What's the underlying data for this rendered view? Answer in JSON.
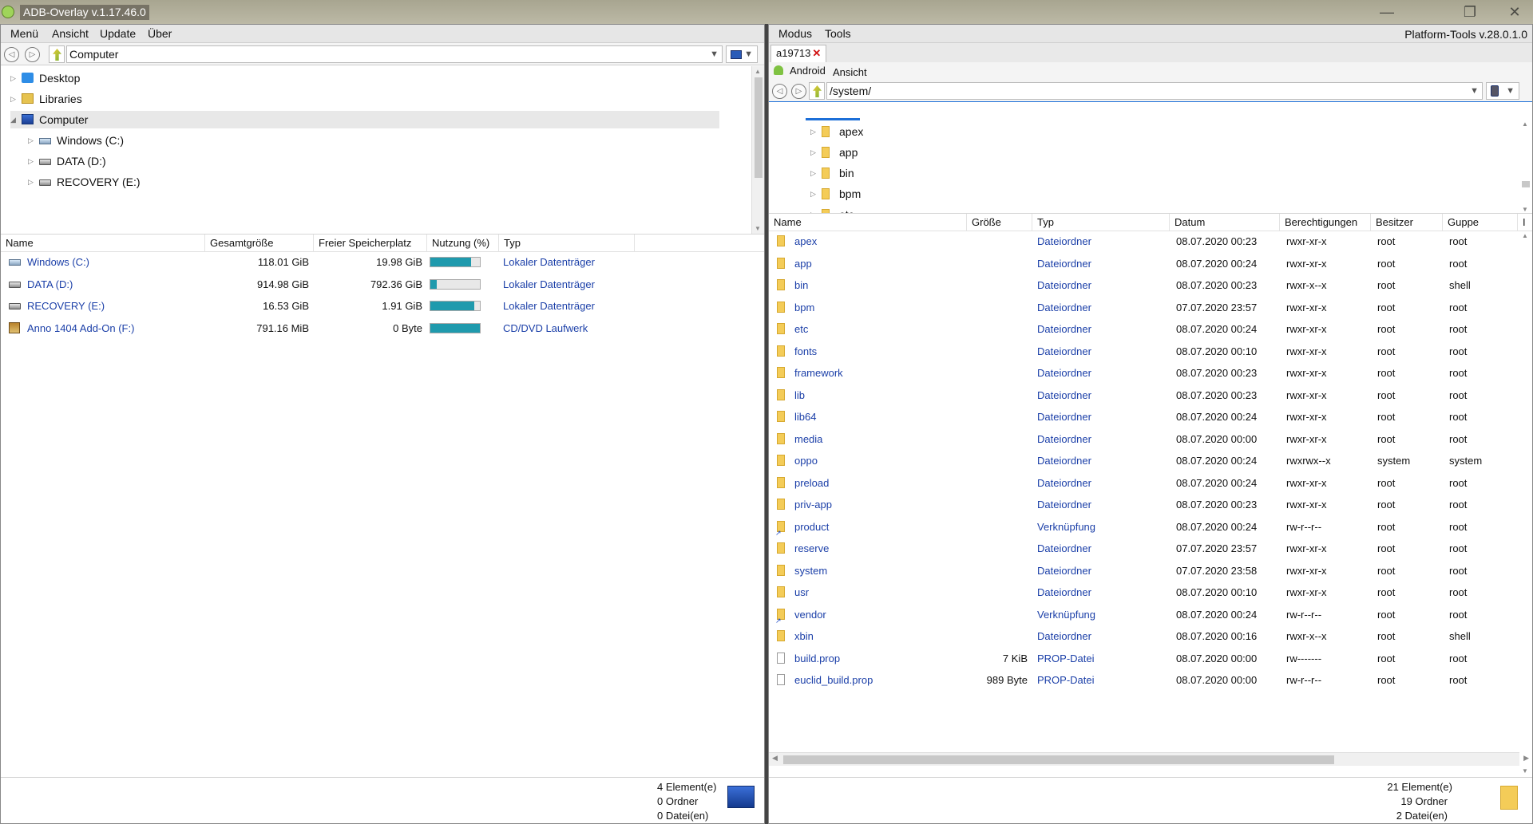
{
  "window": {
    "title": "ADB-Overlay v.1.17.46.0",
    "controls": [
      "minimize-icon",
      "restore-icon",
      "close-icon"
    ]
  },
  "left": {
    "menu": [
      "Menü",
      "Ansicht",
      "Update",
      "Über"
    ],
    "address": {
      "value": "Computer"
    },
    "tree": [
      {
        "label": "Desktop",
        "icon": "desktop-icon",
        "level": 0,
        "expander": "▷"
      },
      {
        "label": "Libraries",
        "icon": "libraries-icon",
        "level": 0,
        "expander": "▷"
      },
      {
        "label": "Computer",
        "icon": "computer-icon",
        "level": 0,
        "expander": "◢"
      },
      {
        "label": "Windows (C:)",
        "icon": "windows-drive-icon",
        "level": 1,
        "expander": "▷"
      },
      {
        "label": "DATA (D:)",
        "icon": "drive-icon",
        "level": 1,
        "expander": "▷"
      },
      {
        "label": "RECOVERY (E:)",
        "icon": "drive-icon",
        "level": 1,
        "expander": "▷"
      }
    ],
    "columns": [
      "Name",
      "Gesamtgröße",
      "Freier Speicherplatz",
      "Nutzung (%)",
      "Typ"
    ],
    "drives": [
      {
        "name": "Windows (C:)",
        "total": "118.01 GiB",
        "free": "19.98 GiB",
        "usage": 83,
        "type": "Lokaler Datenträger",
        "icon": "windows-drive-icon"
      },
      {
        "name": "DATA (D:)",
        "total": "914.98 GiB",
        "free": "792.36 GiB",
        "usage": 13,
        "type": "Lokaler Datenträger",
        "icon": "drive-icon"
      },
      {
        "name": "RECOVERY (E:)",
        "total": "16.53 GiB",
        "free": "1.91 GiB",
        "usage": 88,
        "type": "Lokaler Datenträger",
        "icon": "drive-icon"
      },
      {
        "name": "Anno 1404 Add-On (F:)",
        "total": "791.16 MiB",
        "free": "0 Byte",
        "usage": 100,
        "type": "CD/DVD Laufwerk",
        "icon": "cd-icon"
      }
    ],
    "status": {
      "elements": "4 Element(e)",
      "folders": "0 Ordner",
      "files": "0 Datei(en)"
    }
  },
  "right": {
    "menu": [
      "Modus",
      "Tools"
    ],
    "platform": "Platform-Tools v.28.0.1.0",
    "tab": {
      "label": "a19713",
      "close": "✕"
    },
    "subbar": {
      "android": "Android",
      "ansicht": "Ansicht"
    },
    "address": {
      "value": "/system/"
    },
    "tree": [
      "apex",
      "app",
      "bin",
      "bpm",
      "etc"
    ],
    "columns": [
      "Name",
      "Größe",
      "Typ",
      "Datum",
      "Berechtigungen",
      "Besitzer",
      "Guppe",
      "I"
    ],
    "files": [
      {
        "name": "apex",
        "size": "",
        "type": "Dateiordner",
        "date": "08.07.2020 00:23",
        "perm": "rwxr-xr-x",
        "owner": "root",
        "group": "root",
        "icon": "folder-icon"
      },
      {
        "name": "app",
        "size": "",
        "type": "Dateiordner",
        "date": "08.07.2020 00:24",
        "perm": "rwxr-xr-x",
        "owner": "root",
        "group": "root",
        "icon": "folder-icon"
      },
      {
        "name": "bin",
        "size": "",
        "type": "Dateiordner",
        "date": "08.07.2020 00:23",
        "perm": "rwxr-x--x",
        "owner": "root",
        "group": "shell",
        "icon": "folder-icon"
      },
      {
        "name": "bpm",
        "size": "",
        "type": "Dateiordner",
        "date": "07.07.2020 23:57",
        "perm": "rwxr-xr-x",
        "owner": "root",
        "group": "root",
        "icon": "folder-icon"
      },
      {
        "name": "etc",
        "size": "",
        "type": "Dateiordner",
        "date": "08.07.2020 00:24",
        "perm": "rwxr-xr-x",
        "owner": "root",
        "group": "root",
        "icon": "folder-icon"
      },
      {
        "name": "fonts",
        "size": "",
        "type": "Dateiordner",
        "date": "08.07.2020 00:10",
        "perm": "rwxr-xr-x",
        "owner": "root",
        "group": "root",
        "icon": "folder-icon"
      },
      {
        "name": "framework",
        "size": "",
        "type": "Dateiordner",
        "date": "08.07.2020 00:23",
        "perm": "rwxr-xr-x",
        "owner": "root",
        "group": "root",
        "icon": "folder-icon"
      },
      {
        "name": "lib",
        "size": "",
        "type": "Dateiordner",
        "date": "08.07.2020 00:23",
        "perm": "rwxr-xr-x",
        "owner": "root",
        "group": "root",
        "icon": "folder-icon"
      },
      {
        "name": "lib64",
        "size": "",
        "type": "Dateiordner",
        "date": "08.07.2020 00:24",
        "perm": "rwxr-xr-x",
        "owner": "root",
        "group": "root",
        "icon": "folder-icon"
      },
      {
        "name": "media",
        "size": "",
        "type": "Dateiordner",
        "date": "08.07.2020 00:00",
        "perm": "rwxr-xr-x",
        "owner": "root",
        "group": "root",
        "icon": "folder-icon"
      },
      {
        "name": "oppo",
        "size": "",
        "type": "Dateiordner",
        "date": "08.07.2020 00:24",
        "perm": "rwxrwx--x",
        "owner": "system",
        "group": "system",
        "icon": "folder-icon"
      },
      {
        "name": "preload",
        "size": "",
        "type": "Dateiordner",
        "date": "08.07.2020 00:24",
        "perm": "rwxr-xr-x",
        "owner": "root",
        "group": "root",
        "icon": "folder-icon"
      },
      {
        "name": "priv-app",
        "size": "",
        "type": "Dateiordner",
        "date": "08.07.2020 00:23",
        "perm": "rwxr-xr-x",
        "owner": "root",
        "group": "root",
        "icon": "folder-icon"
      },
      {
        "name": "product",
        "size": "",
        "type": "Verknüpfung",
        "date": "08.07.2020 00:24",
        "perm": "rw-r--r--",
        "owner": "root",
        "group": "root",
        "icon": "link-icon"
      },
      {
        "name": "reserve",
        "size": "",
        "type": "Dateiordner",
        "date": "07.07.2020 23:57",
        "perm": "rwxr-xr-x",
        "owner": "root",
        "group": "root",
        "icon": "folder-icon"
      },
      {
        "name": "system",
        "size": "",
        "type": "Dateiordner",
        "date": "07.07.2020 23:58",
        "perm": "rwxr-xr-x",
        "owner": "root",
        "group": "root",
        "icon": "folder-icon"
      },
      {
        "name": "usr",
        "size": "",
        "type": "Dateiordner",
        "date": "08.07.2020 00:10",
        "perm": "rwxr-xr-x",
        "owner": "root",
        "group": "root",
        "icon": "folder-icon"
      },
      {
        "name": "vendor",
        "size": "",
        "type": "Verknüpfung",
        "date": "08.07.2020 00:24",
        "perm": "rw-r--r--",
        "owner": "root",
        "group": "root",
        "icon": "link-icon"
      },
      {
        "name": "xbin",
        "size": "",
        "type": "Dateiordner",
        "date": "08.07.2020 00:16",
        "perm": "rwxr-x--x",
        "owner": "root",
        "group": "shell",
        "icon": "folder-icon"
      },
      {
        "name": "build.prop",
        "size": "7 KiB",
        "type": "PROP-Datei",
        "date": "08.07.2020 00:00",
        "perm": "rw-------",
        "owner": "root",
        "group": "root",
        "icon": "file-icon"
      },
      {
        "name": "euclid_build.prop",
        "size": "989 Byte",
        "type": "PROP-Datei",
        "date": "08.07.2020 00:00",
        "perm": "rw-r--r--",
        "owner": "root",
        "group": "root",
        "icon": "file-icon"
      }
    ],
    "status": {
      "elements": "21 Element(e)",
      "folders": "19 Ordner",
      "files": "2 Datei(en)"
    }
  },
  "colors": {
    "link": "#1b3fa8",
    "usage_bar": "#1f9aad",
    "close_x": "#d01010"
  }
}
